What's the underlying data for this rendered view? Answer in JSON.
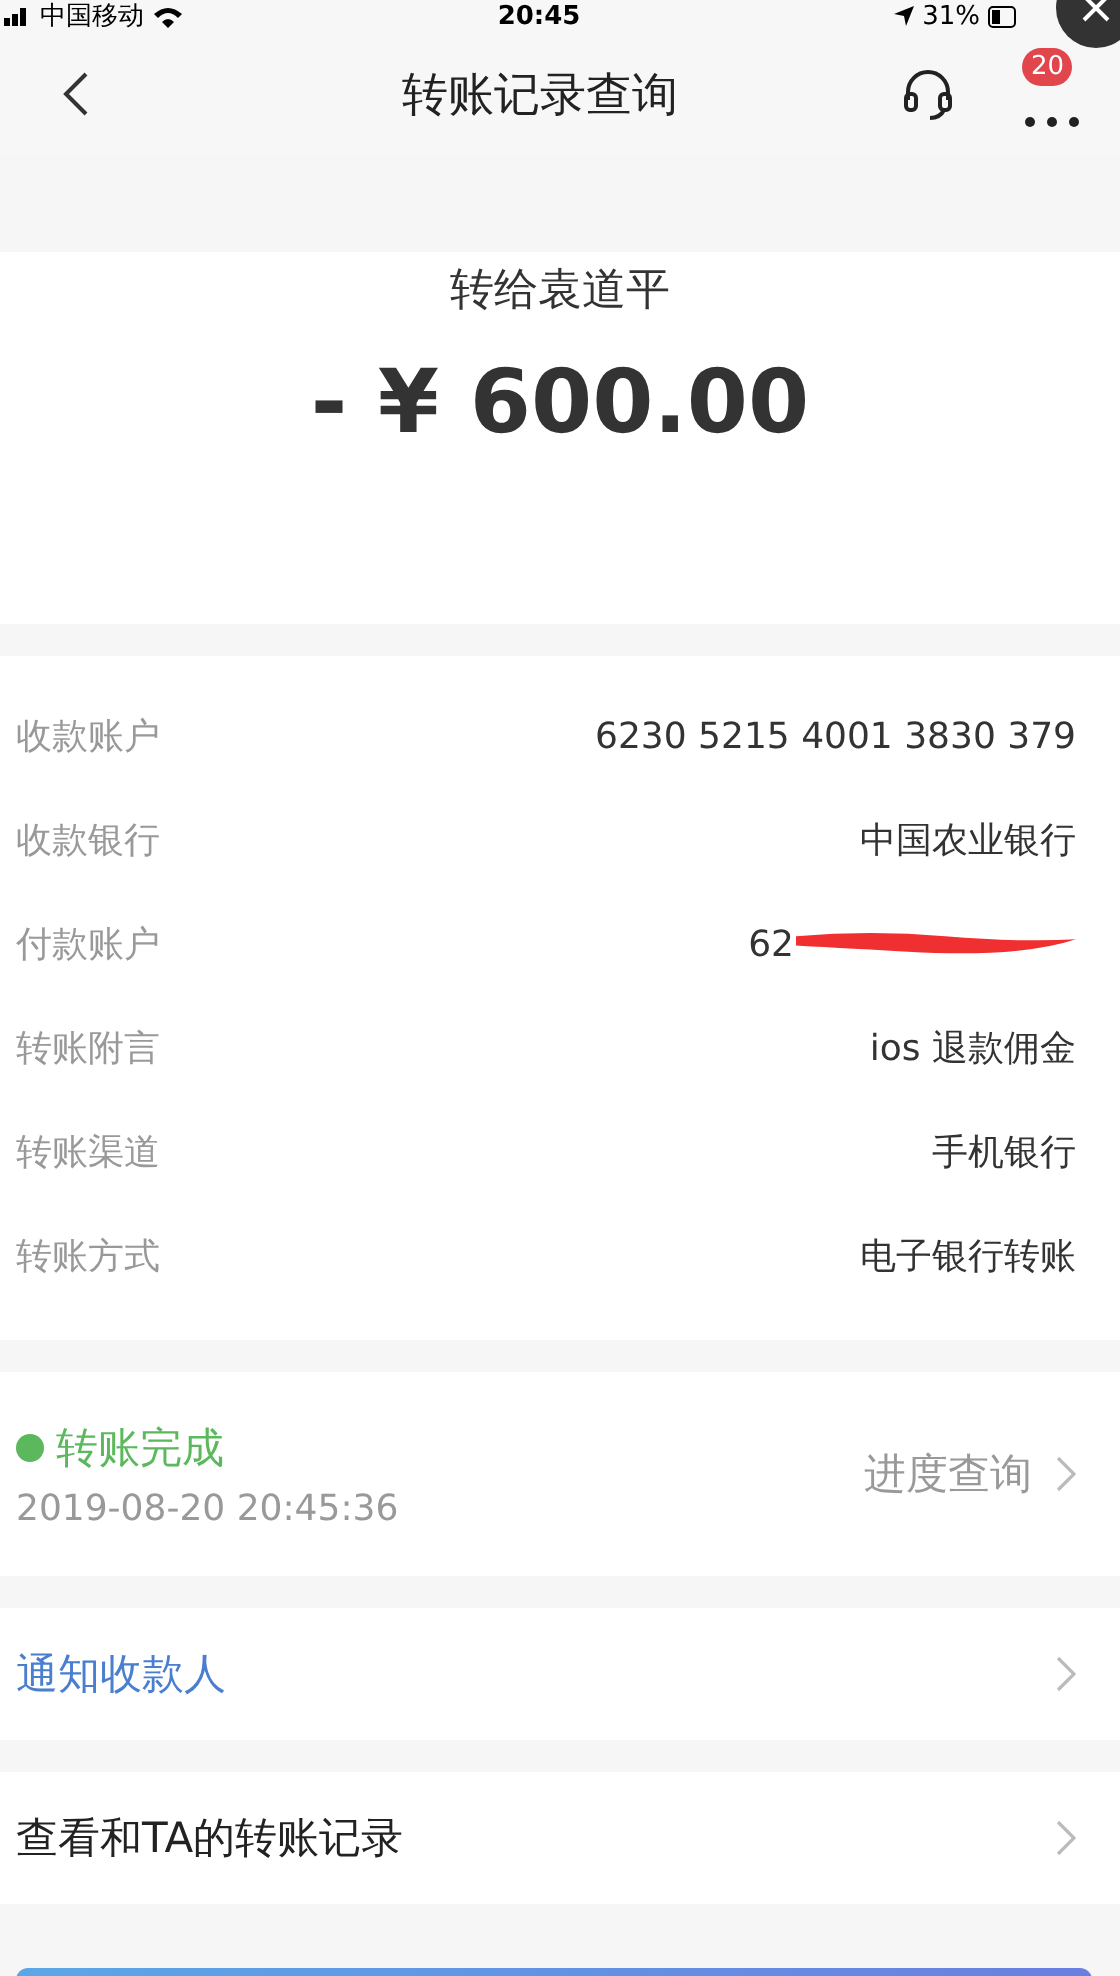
{
  "status_bar": {
    "carrier": "中国移动",
    "time": "20:45",
    "battery": "31%"
  },
  "nav": {
    "title": "转账记录查询",
    "badge": "20"
  },
  "summary": {
    "recipient": "转给袁道平",
    "amount": "- ¥ 600.00"
  },
  "details": [
    {
      "label": "收款账户",
      "value": "6230 5215 4001 3830 379",
      "redacted": false
    },
    {
      "label": "收款银行",
      "value": "中国农业银行",
      "redacted": false
    },
    {
      "label": "付款账户",
      "value": "62",
      "redacted": true
    },
    {
      "label": "转账附言",
      "value": "ios 退款佣金",
      "redacted": false
    },
    {
      "label": "转账渠道",
      "value": "手机银行",
      "redacted": false
    },
    {
      "label": "转账方式",
      "value": "电子银行转账",
      "redacted": false
    }
  ],
  "progress": {
    "status": "转账完成",
    "color": "#5cb85c",
    "time": "2019-08-20 20:45:36",
    "link": "进度查询"
  },
  "links": [
    {
      "label": "通知收款人",
      "kind": "accent"
    },
    {
      "label": "查看和TA的转账记录",
      "kind": "plain"
    }
  ]
}
